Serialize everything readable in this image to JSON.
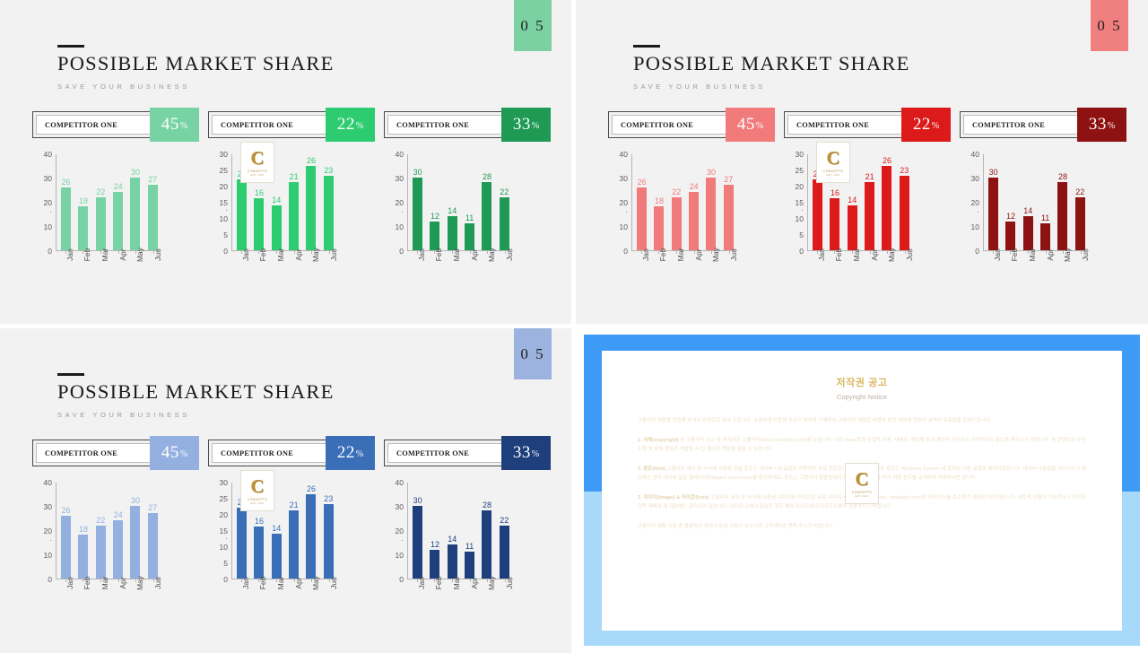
{
  "slides": [
    {
      "id": "green",
      "page_number": "0 5",
      "title": "POSSIBLE MARKET SHARE",
      "subtitle": "SAVE YOUR BUSINESS",
      "badge_color": "#7BD1A2",
      "columns": [
        {
          "label": "COMPETITOR ONE",
          "percent": "45",
          "percent_symbol": "%",
          "color": "#78D3A4"
        },
        {
          "label": "COMPETITOR ONE",
          "percent": "22",
          "percent_symbol": "%",
          "color": "#2ECC71"
        },
        {
          "label": "COMPETITOR ONE",
          "percent": "33",
          "percent_symbol": "%",
          "color": "#1E9A55"
        }
      ]
    },
    {
      "id": "red",
      "page_number": "0 5",
      "title": "POSSIBLE MARKET SHARE",
      "subtitle": "SAVE YOUR BUSINESS",
      "badge_color": "#F08080",
      "columns": [
        {
          "label": "COMPETITOR ONE",
          "percent": "45",
          "percent_symbol": "%",
          "color": "#F17B7B"
        },
        {
          "label": "COMPETITOR ONE",
          "percent": "22",
          "percent_symbol": "%",
          "color": "#DC1A1A"
        },
        {
          "label": "COMPETITOR ONE",
          "percent": "33",
          "percent_symbol": "%",
          "color": "#8E1212"
        }
      ]
    },
    {
      "id": "blue",
      "page_number": "0 5",
      "title": "POSSIBLE MARKET SHARE",
      "subtitle": "SAVE YOUR BUSINESS",
      "badge_color": "#9BB3DE",
      "columns": [
        {
          "label": "COMPETITOR ONE",
          "percent": "45",
          "percent_symbol": "%",
          "color": "#93B0E0"
        },
        {
          "label": "COMPETITOR ONE",
          "percent": "22",
          "percent_symbol": "%",
          "color": "#3A6FB8"
        },
        {
          "label": "COMPETITOR ONE",
          "percent": "33",
          "percent_symbol": "%",
          "color": "#1E3F7C"
        }
      ]
    }
  ],
  "chart_data": [
    {
      "type": "bar",
      "title": "Competitor One 45%",
      "categories": [
        "Jan",
        "Feb",
        "Mar",
        "Apr",
        "May",
        "Jun"
      ],
      "values": [
        26,
        18,
        22,
        24,
        30,
        27
      ],
      "yticks": [
        40,
        30,
        20,
        10,
        0
      ],
      "ylim": [
        0,
        40
      ],
      "xlabel": "",
      "ylabel": "",
      "grid": false,
      "legend": "none"
    },
    {
      "type": "bar",
      "title": "Competitor One 22%",
      "categories": [
        "Jan",
        "Feb",
        "Mar",
        "Apr",
        "May",
        "Jun"
      ],
      "values": [
        22,
        16,
        14,
        21,
        26,
        23
      ],
      "yticks": [
        30,
        25,
        20,
        15,
        10,
        5,
        0
      ],
      "ylim": [
        0,
        30
      ],
      "xlabel": "",
      "ylabel": "",
      "grid": false,
      "legend": "none"
    },
    {
      "type": "bar",
      "title": "Competitor One 33%",
      "categories": [
        "Jan",
        "Feb",
        "Mar",
        "Apr",
        "May",
        "Jun"
      ],
      "values": [
        30,
        12,
        14,
        11,
        28,
        22
      ],
      "yticks": [
        40,
        30,
        20,
        10,
        0
      ],
      "ylim": [
        0,
        40
      ],
      "xlabel": "",
      "ylabel": "",
      "grid": false,
      "legend": "none"
    }
  ],
  "logo": {
    "mark": "C",
    "line1": "CONCEPTS",
    "line2": "EST. 2015"
  },
  "copyright": {
    "band_top_color": "#3D9BF5",
    "band_bottom_color": "#A9D9FA",
    "title": "저작권 공고",
    "subtitle": "Copyright Notice",
    "paragraphs": [
      "고퀄리티 제품을 이용해 주셔서 진심으로 감사 드립니다. 소중하게 이용해 주시기 바라며 구매하신 고퀄리티 제품은 사용자 본인 사용에 한하여 효력이 유효함을 알려드립니다.",
      "<b>1. 서체(copyright)</b> 본 고퀄리티 소스 및 저작권은 고퀄리티(www.concepts.com)에 있습니다. 시판 www 등의 상업적 이용, 재배포, 재판매 등의 행위가 무단으로 이루어지지 않도록 해주시기 바랍니다. 본 콘텐츠의 무단 도용 및 복제 행위가 적발될 시 민·형사상 책임을 물을 수 있습니다.",
      "<b>2. 폰트(font)</b> 고퀄리티 내지 본 서식에 사용된 한글 폰트는 네이버 나눔글꼴로 이루어진 무료 폰트입니다. 한글 외의 영문 폰트는 Windows System 내 설치된 기본 글꼴로 제작되었습니다. 네이버 나눔글꼴 라이선스가 필요하신 경우 네이버 글꼴 홈페이지(hangeul.naver.com)를 참조하세요. 폰트는 고퀄리티 템플릿에서 제공되므로 필요에 따라 적용 폰트를 교체하여 사용하시면 됩니다.",
      "<b>3. 이미지(Image) & 아이콘(Icon)</b> 고퀄리티 내지 본 서식에 사용된 이미지와 아이콘은 무료 이미지 사이트(pixabay.com, unsplash.com)의 라이선스를 준수하여 제작된 이미지입니다. 상업적 이용이 가능하오나 이미지 단독 재배포 및 재판매는 금지되어 있습니다. 이미지 교체가 필요한 경우 해당 사이트에서 다운로드하여 사용하시기 바랍니다.",
      "고퀄리티 제품 이용 중 불편하신 점이나 문의 사항이 있으시면 고객센터로 연락 주시기 바랍니다."
    ]
  }
}
